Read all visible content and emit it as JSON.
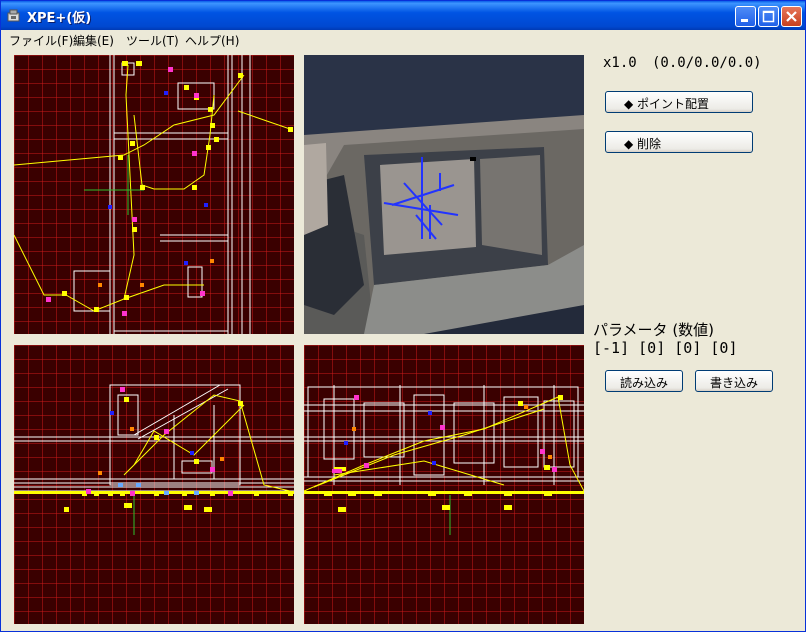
{
  "window": {
    "title": "XPE+(仮)"
  },
  "menu": [
    "ファイル(F)",
    "編集(E)",
    "ツール(T)",
    "ヘルプ(H)"
  ],
  "view": {
    "zoom": "x1.0",
    "position": "(0.0/0.0/0.0)"
  },
  "buttons": {
    "point_place": "◆ ポイント配置",
    "delete": "◆ 削除",
    "load": "読み込み",
    "write": "書き込み"
  },
  "params": {
    "label": "パラメータ (数値)",
    "values": "[-1] [0] [0] [0]"
  },
  "colors": {
    "grid": "#cc1a1a",
    "background": "#3a0000",
    "wire": "#ffffff",
    "path": "#ffff00",
    "marker_pink": "#ff33cc",
    "marker_blue": "#2020ff",
    "marker_orange": "#ff8800"
  }
}
